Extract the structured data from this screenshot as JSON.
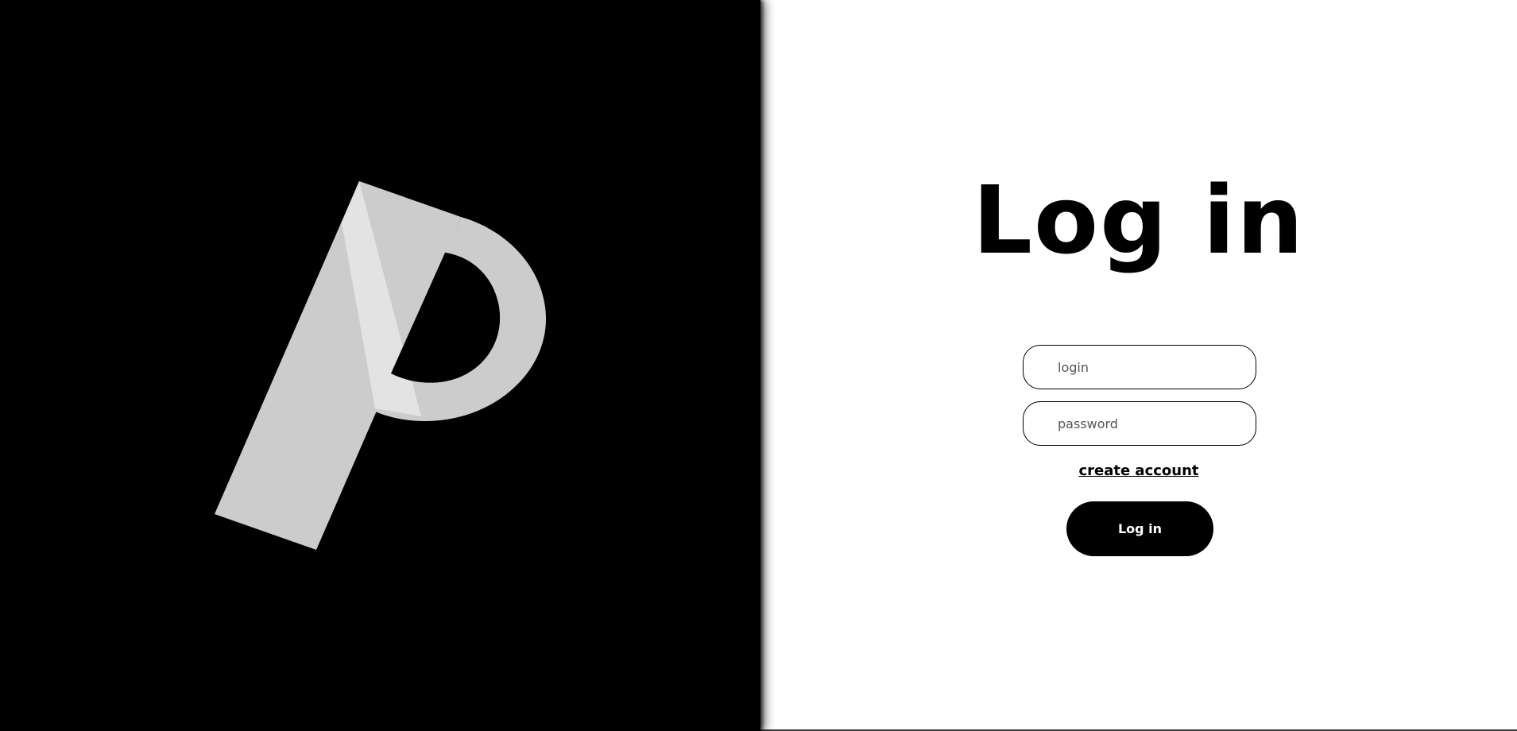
{
  "brand": {
    "logo_icon": "p-letter-logo-icon",
    "colors": {
      "panel": "#000000",
      "logo": "#cccccc",
      "logo_highlight": "#e3e3e3"
    }
  },
  "login_form": {
    "title": "Log in",
    "login_field": {
      "placeholder": "login",
      "value": ""
    },
    "password_field": {
      "placeholder": "password",
      "value": ""
    },
    "create_account_label": "create account",
    "submit_label": "Log in"
  }
}
